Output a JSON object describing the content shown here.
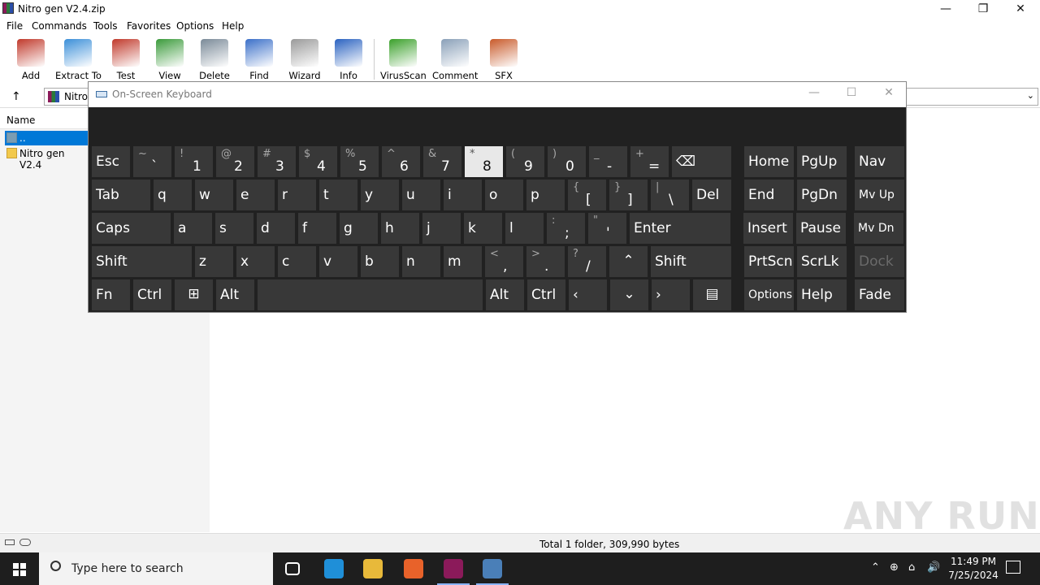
{
  "window": {
    "title": "Nitro gen V2.4.zip",
    "minimize": "—",
    "maximize": "❐",
    "close": "✕"
  },
  "menu": [
    "File",
    "Commands",
    "Tools",
    "Favorites",
    "Options",
    "Help"
  ],
  "toolbar": [
    {
      "label": "Add",
      "icon": "add-archive-icon",
      "color": "#c0392b"
    },
    {
      "label": "Extract To",
      "icon": "extract-folder-icon",
      "color": "#3b8fd8"
    },
    {
      "label": "Test",
      "icon": "test-checklist-icon",
      "color": "#c0392b"
    },
    {
      "label": "View",
      "icon": "view-book-icon",
      "color": "#3a9a3a"
    },
    {
      "label": "Delete",
      "icon": "trash-icon",
      "color": "#7a8a98"
    },
    {
      "label": "Find",
      "icon": "magnifier-icon",
      "color": "#3a6fc8"
    },
    {
      "label": "Wizard",
      "icon": "magic-wand-icon",
      "color": "#9a9a9a"
    },
    {
      "label": "Info",
      "icon": "info-icon",
      "color": "#2a62c0"
    },
    {
      "label": "VirusScan",
      "icon": "virus-scan-icon",
      "color": "#3aa02a"
    },
    {
      "label": "Comment",
      "icon": "comment-icon",
      "color": "#8aa0b8"
    },
    {
      "label": "SFX",
      "icon": "sfx-archive-icon",
      "color": "#c85a2a"
    }
  ],
  "address": {
    "path": "Nitro"
  },
  "filelist": {
    "header": "Name",
    "rows": [
      {
        "name": "..",
        "selected": true
      },
      {
        "name": "Nitro gen V2.4",
        "selected": false
      }
    ]
  },
  "status": {
    "summary": "Total 1 folder, 309,990 bytes"
  },
  "watermark": "ANY RUN",
  "osk": {
    "title": "On-Screen Keyboard",
    "minimize": "—",
    "maximize": "☐",
    "close": "✕",
    "rows": [
      [
        {
          "label": "Esc",
          "w": 47,
          "type": "plain"
        },
        {
          "shift": "~",
          "main": "`",
          "w": 47
        },
        {
          "shift": "!",
          "main": "1",
          "w": 47
        },
        {
          "shift": "@",
          "main": "2",
          "w": 47
        },
        {
          "shift": "#",
          "main": "3",
          "w": 47
        },
        {
          "shift": "$",
          "main": "4",
          "w": 47
        },
        {
          "shift": "%",
          "main": "5",
          "w": 47
        },
        {
          "shift": "^",
          "main": "6",
          "w": 47
        },
        {
          "shift": "&",
          "main": "7",
          "w": 47
        },
        {
          "shift": "*",
          "main": "8",
          "w": 47,
          "hl": true
        },
        {
          "shift": "(",
          "main": "9",
          "w": 47
        },
        {
          "shift": ")",
          "main": "0",
          "w": 47
        },
        {
          "shift": "_",
          "main": "-",
          "w": 47
        },
        {
          "shift": "+",
          "main": "=",
          "w": 47
        },
        {
          "label": "⌫",
          "w": 73,
          "type": "plain"
        },
        {
          "label": "Home",
          "w": 61,
          "type": "plain",
          "gap": 12
        },
        {
          "label": "PgUp",
          "w": 61,
          "type": "plain"
        },
        {
          "label": "Nav",
          "w": 61,
          "type": "plain",
          "gap": 6
        }
      ],
      [
        {
          "label": "Tab",
          "w": 72,
          "type": "plain"
        },
        {
          "label": "q",
          "w": 47,
          "type": "plain"
        },
        {
          "label": "w",
          "w": 47,
          "type": "plain"
        },
        {
          "label": "e",
          "w": 47,
          "type": "plain"
        },
        {
          "label": "r",
          "w": 47,
          "type": "plain"
        },
        {
          "label": "t",
          "w": 47,
          "type": "plain"
        },
        {
          "label": "y",
          "w": 47,
          "type": "plain"
        },
        {
          "label": "u",
          "w": 47,
          "type": "plain"
        },
        {
          "label": "i",
          "w": 47,
          "type": "plain"
        },
        {
          "label": "o",
          "w": 47,
          "type": "plain"
        },
        {
          "label": "p",
          "w": 47,
          "type": "plain"
        },
        {
          "shift": "{",
          "main": "[",
          "w": 47
        },
        {
          "shift": "}",
          "main": "]",
          "w": 47
        },
        {
          "shift": "|",
          "main": "\\",
          "w": 47
        },
        {
          "label": "Del",
          "w": 48,
          "type": "plain"
        },
        {
          "label": "End",
          "w": 61,
          "type": "plain",
          "gap": 12
        },
        {
          "label": "PgDn",
          "w": 61,
          "type": "plain"
        },
        {
          "label": "Mv Up",
          "w": 61,
          "type": "plain",
          "small": true,
          "gap": 6
        }
      ],
      [
        {
          "label": "Caps",
          "w": 97,
          "type": "plain"
        },
        {
          "label": "a",
          "w": 47,
          "type": "plain"
        },
        {
          "label": "s",
          "w": 47,
          "type": "plain"
        },
        {
          "label": "d",
          "w": 47,
          "type": "plain"
        },
        {
          "label": "f",
          "w": 47,
          "type": "plain"
        },
        {
          "label": "g",
          "w": 47,
          "type": "plain"
        },
        {
          "label": "h",
          "w": 47,
          "type": "plain"
        },
        {
          "label": "j",
          "w": 47,
          "type": "plain"
        },
        {
          "label": "k",
          "w": 47,
          "type": "plain"
        },
        {
          "label": "l",
          "w": 47,
          "type": "plain"
        },
        {
          "shift": ":",
          "main": ";",
          "w": 47
        },
        {
          "shift": "\"",
          "main": "'",
          "w": 47
        },
        {
          "label": "Enter",
          "w": 124,
          "type": "plain"
        },
        {
          "label": "Insert",
          "w": 61,
          "type": "plain",
          "gap": 12
        },
        {
          "label": "Pause",
          "w": 61,
          "type": "plain"
        },
        {
          "label": "Mv Dn",
          "w": 61,
          "type": "plain",
          "small": true,
          "gap": 6
        }
      ],
      [
        {
          "label": "Shift",
          "w": 123,
          "type": "plain"
        },
        {
          "label": "z",
          "w": 47,
          "type": "plain"
        },
        {
          "label": "x",
          "w": 47,
          "type": "plain"
        },
        {
          "label": "c",
          "w": 47,
          "type": "plain"
        },
        {
          "label": "v",
          "w": 47,
          "type": "plain"
        },
        {
          "label": "b",
          "w": 47,
          "type": "plain"
        },
        {
          "label": "n",
          "w": 47,
          "type": "plain"
        },
        {
          "label": "m",
          "w": 47,
          "type": "plain"
        },
        {
          "shift": "<",
          "main": ",",
          "w": 47
        },
        {
          "shift": ">",
          "main": ".",
          "w": 47
        },
        {
          "shift": "?",
          "main": "/",
          "w": 47
        },
        {
          "label": "⌃",
          "w": 47,
          "type": "center"
        },
        {
          "label": "Shift",
          "w": 99,
          "type": "plain"
        },
        {
          "label": "PrtScn",
          "w": 61,
          "type": "plain",
          "gap": 12
        },
        {
          "label": "ScrLk",
          "w": 61,
          "type": "plain"
        },
        {
          "label": "Dock",
          "w": 61,
          "type": "plain",
          "dim": true,
          "gap": 6
        }
      ],
      [
        {
          "label": "Fn",
          "w": 47,
          "type": "plain"
        },
        {
          "label": "Ctrl",
          "w": 47,
          "type": "plain"
        },
        {
          "label": "⊞",
          "w": 47,
          "type": "center"
        },
        {
          "label": "Alt",
          "w": 47,
          "type": "plain"
        },
        {
          "label": "",
          "w": 277,
          "type": "plain"
        },
        {
          "label": "Alt",
          "w": 47,
          "type": "plain"
        },
        {
          "label": "Ctrl",
          "w": 47,
          "type": "plain"
        },
        {
          "label": "‹",
          "w": 47,
          "type": "plain"
        },
        {
          "label": "⌄",
          "w": 47,
          "type": "center"
        },
        {
          "label": "›",
          "w": 47,
          "type": "plain"
        },
        {
          "label": "▤",
          "w": 47,
          "type": "center"
        },
        {
          "label": "Options",
          "w": 61,
          "type": "plain",
          "small": true,
          "gap": 12
        },
        {
          "label": "Help",
          "w": 61,
          "type": "plain"
        },
        {
          "label": "Fade",
          "w": 61,
          "type": "plain",
          "gap": 6
        }
      ]
    ]
  },
  "taskbar": {
    "search_placeholder": "Type here to search",
    "apps": [
      {
        "name": "task-view-icon",
        "color": "#1e1e1e"
      },
      {
        "name": "edge-icon",
        "color": "#1f8fd8"
      },
      {
        "name": "file-explorer-icon",
        "color": "#e8b93a"
      },
      {
        "name": "firefox-icon",
        "color": "#e8622a"
      },
      {
        "name": "winrar-icon",
        "color": "#8b1a5a",
        "active": true
      },
      {
        "name": "osk-app-icon",
        "color": "#4a7fb8",
        "active": true
      }
    ],
    "tray": [
      "⌃",
      "⊕",
      "⌂",
      "🔊"
    ],
    "time": "11:49 PM",
    "date": "7/25/2024"
  }
}
